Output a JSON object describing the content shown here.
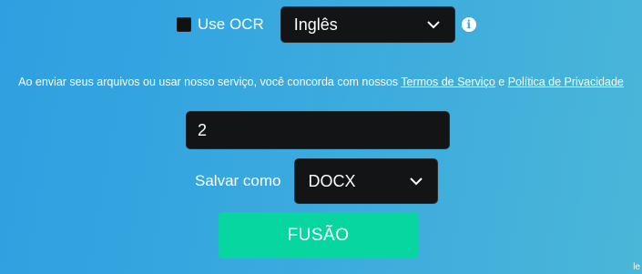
{
  "ocr": {
    "label": "Use OCR",
    "checked": false,
    "language_selected": "Inglês",
    "info_icon": "info-icon"
  },
  "terms": {
    "prefix": "Ao enviar seus arquivos ou usar nosso serviço, você concorda com nossos ",
    "terms_link": "Termos de Serviço",
    "conjunction": " e ",
    "privacy_link": "Política de Privacidade"
  },
  "pages_input": {
    "value": "2"
  },
  "save_as": {
    "label": "Salvar como",
    "format_selected": "DOCX"
  },
  "merge_button": {
    "label": "FUSÃO",
    "color": "#08d6a0"
  },
  "corner_mark": "le"
}
